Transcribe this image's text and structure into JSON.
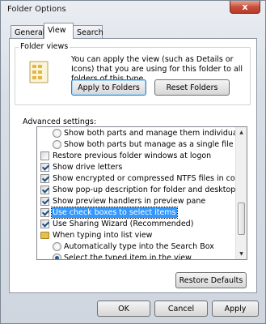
{
  "window": {
    "title": "Folder Options",
    "close_label": "x"
  },
  "tabs": [
    {
      "label": "General"
    },
    {
      "label": "View"
    },
    {
      "label": "Search"
    }
  ],
  "folder_views": {
    "title": "Folder views",
    "description": "You can apply the view (such as Details or Icons) that you are using for this folder to all folders of this type.",
    "apply_label": "Apply to Folders",
    "reset_label": "Reset Folders"
  },
  "advanced": {
    "label": "Advanced settings:",
    "items": [
      {
        "type": "radio",
        "checked": false,
        "indent": 2,
        "label": "Show both parts and manage them individually"
      },
      {
        "type": "radio",
        "checked": false,
        "indent": 2,
        "label": "Show both parts but manage as a single file"
      },
      {
        "type": "checkbox",
        "checked": false,
        "indent": 1,
        "label": "Restore previous folder windows at logon"
      },
      {
        "type": "checkbox",
        "checked": true,
        "indent": 1,
        "label": "Show drive letters"
      },
      {
        "type": "checkbox",
        "checked": true,
        "indent": 1,
        "label": "Show encrypted or compressed NTFS files in color"
      },
      {
        "type": "checkbox",
        "checked": true,
        "indent": 1,
        "label": "Show pop-up description for folder and desktop items"
      },
      {
        "type": "checkbox",
        "checked": true,
        "indent": 1,
        "label": "Show preview handlers in preview pane"
      },
      {
        "type": "checkbox",
        "checked": true,
        "indent": 1,
        "label": "Use check boxes to select items",
        "selected": true
      },
      {
        "type": "checkbox",
        "checked": true,
        "indent": 1,
        "label": "Use Sharing Wizard (Recommended)"
      },
      {
        "type": "folder",
        "indent": 1,
        "label": "When typing into list view"
      },
      {
        "type": "radio",
        "checked": false,
        "indent": 2,
        "label": "Automatically type into the Search Box"
      },
      {
        "type": "radio",
        "checked": true,
        "indent": 2,
        "label": "Select the typed item in the view"
      }
    ]
  },
  "restore_defaults_label": "Restore Defaults",
  "footer": {
    "ok_label": "OK",
    "cancel_label": "Cancel",
    "apply_label": "Apply"
  }
}
